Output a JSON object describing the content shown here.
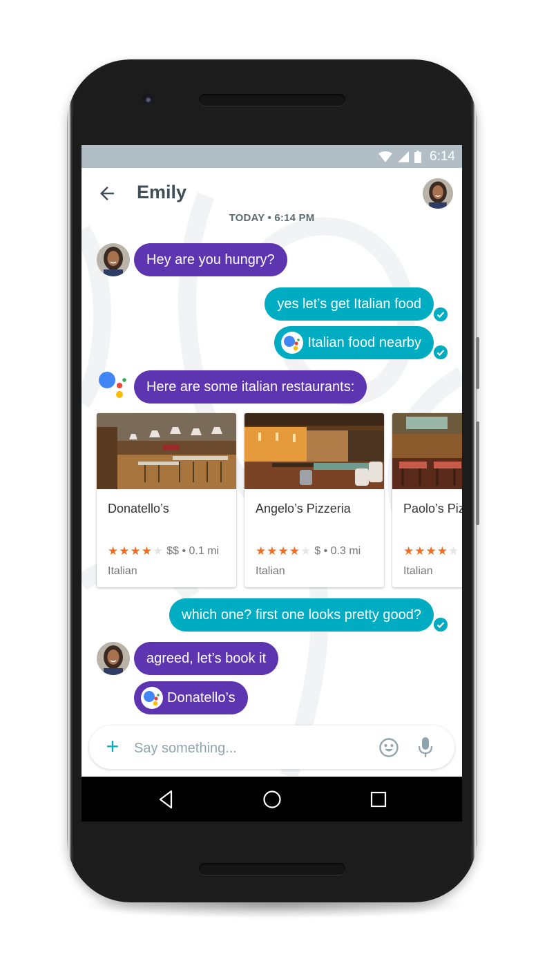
{
  "device": {
    "model": "Android phone"
  },
  "status_bar": {
    "time": "6:14",
    "icons": [
      "wifi-icon",
      "cellular-signal-icon",
      "battery-icon"
    ]
  },
  "app_bar": {
    "title": "Emily",
    "back_icon": "arrow-back-icon"
  },
  "conversation": {
    "date_label": "TODAY • 6:14 PM",
    "messages": [
      {
        "sender": "Emily",
        "direction": "incoming",
        "text": "Hey are you hungry?"
      },
      {
        "sender": "me",
        "direction": "outgoing",
        "text": "yes let’s get Italian food",
        "status": "delivered"
      },
      {
        "sender": "me",
        "direction": "outgoing",
        "text": "Italian food nearby",
        "assistant_query": true,
        "status": "delivered"
      },
      {
        "sender": "Google Assistant",
        "direction": "incoming",
        "text": "Here are some italian restaurants:"
      },
      {
        "sender": "me",
        "direction": "outgoing",
        "text": "which one? first one looks pretty good?",
        "status": "delivered"
      },
      {
        "sender": "Emily",
        "direction": "incoming",
        "text": "agreed, let’s book it"
      },
      {
        "sender": "Emily",
        "direction": "incoming",
        "text": "Donatello’s",
        "assistant_query": true
      }
    ],
    "restaurants": [
      {
        "name": "Donatello’s",
        "rating": 4,
        "rating_max": 5,
        "price": "$$",
        "distance": "0.1 mi",
        "category": "Italian"
      },
      {
        "name": "Angelo’s Pizzeria",
        "rating": 4,
        "rating_max": 5,
        "price": "$",
        "distance": "0.3 mi",
        "category": "Italian"
      },
      {
        "name": "Paolo’s Pizzeria",
        "rating": 4,
        "rating_max": 5,
        "price": "",
        "distance": "",
        "category": "Italian"
      }
    ]
  },
  "composer": {
    "placeholder": "Say something...",
    "value": ""
  },
  "nav_bar": {
    "buttons": [
      "back",
      "home",
      "recents"
    ]
  },
  "colors": {
    "incoming_bubble": "#5e35b1",
    "outgoing_bubble": "#00acc1",
    "status_bar": "#b1bec6",
    "star": "#f06d1f"
  }
}
